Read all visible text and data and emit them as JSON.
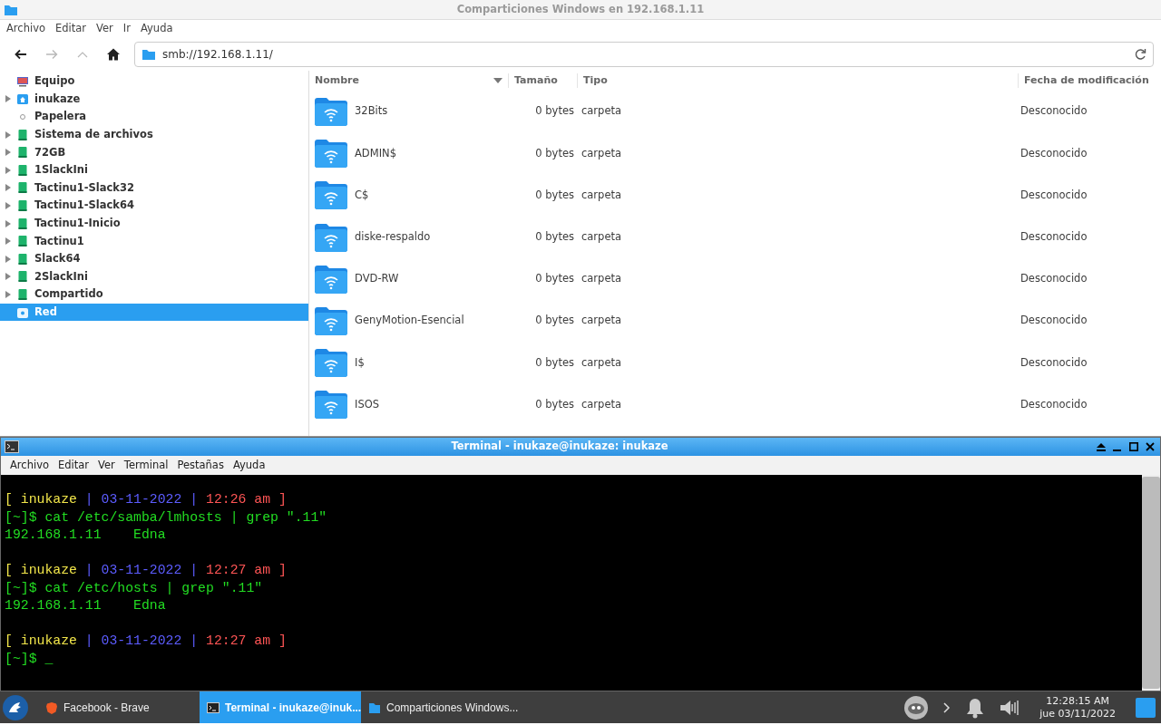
{
  "file_manager": {
    "title": "Comparticiones Windows en 192.168.1.11",
    "menu": [
      "Archivo",
      "Editar",
      "Ver",
      "Ir",
      "Ayuda"
    ],
    "toolbar": {
      "back_disabled": false,
      "forward_disabled": true,
      "up_disabled": true
    },
    "location": "smb://192.168.1.11/",
    "sidebar": {
      "items": [
        {
          "label": "Equipo",
          "kind": "computer",
          "expander": false,
          "selected": false
        },
        {
          "label": "inukaze",
          "kind": "home",
          "expander": true,
          "selected": false
        },
        {
          "label": "Papelera",
          "kind": "trash",
          "expander": false,
          "selected": false
        },
        {
          "label": "Sistema de archivos",
          "kind": "drive",
          "expander": true,
          "selected": false
        },
        {
          "label": "72GB",
          "kind": "drive",
          "expander": true,
          "selected": false
        },
        {
          "label": "1SlackIni",
          "kind": "drive",
          "expander": true,
          "selected": false
        },
        {
          "label": "Tactinu1-Slack32",
          "kind": "drive",
          "expander": true,
          "selected": false
        },
        {
          "label": "Tactinu1-Slack64",
          "kind": "drive",
          "expander": true,
          "selected": false
        },
        {
          "label": "Tactinu1-Inicio",
          "kind": "drive",
          "expander": true,
          "selected": false
        },
        {
          "label": "Tactinu1",
          "kind": "drive",
          "expander": true,
          "selected": false
        },
        {
          "label": "Slack64",
          "kind": "drive",
          "expander": true,
          "selected": false
        },
        {
          "label": "2SlackIni",
          "kind": "drive",
          "expander": true,
          "selected": false
        },
        {
          "label": "Compartido",
          "kind": "drive",
          "expander": true,
          "selected": false
        },
        {
          "label": "Red",
          "kind": "network",
          "expander": false,
          "selected": true
        }
      ]
    },
    "table": {
      "columns": [
        {
          "label": "Nombre",
          "sorted": true
        },
        {
          "label": "Tamaño",
          "sorted": false
        },
        {
          "label": "Tipo",
          "sorted": false
        },
        {
          "label": "Fecha de modificación",
          "sorted": false
        }
      ],
      "rows": [
        {
          "name": "32Bits",
          "size": "0 bytes",
          "type": "carpeta",
          "modified": "Desconocido"
        },
        {
          "name": "ADMIN$",
          "size": "0 bytes",
          "type": "carpeta",
          "modified": "Desconocido"
        },
        {
          "name": "C$",
          "size": "0 bytes",
          "type": "carpeta",
          "modified": "Desconocido"
        },
        {
          "name": "diske-respaldo",
          "size": "0 bytes",
          "type": "carpeta",
          "modified": "Desconocido"
        },
        {
          "name": "DVD-RW",
          "size": "0 bytes",
          "type": "carpeta",
          "modified": "Desconocido"
        },
        {
          "name": "GenyMotion-Esencial",
          "size": "0 bytes",
          "type": "carpeta",
          "modified": "Desconocido"
        },
        {
          "name": "I$",
          "size": "0 bytes",
          "type": "carpeta",
          "modified": "Desconocido"
        },
        {
          "name": "ISOS",
          "size": "0 bytes",
          "type": "carpeta",
          "modified": "Desconocido"
        }
      ]
    }
  },
  "terminal": {
    "title": "Terminal - inukaze@inukaze: inukaze",
    "menu": [
      "Archivo",
      "Editar",
      "Ver",
      "Terminal",
      "Pestañas",
      "Ayuda"
    ],
    "blocks": [
      {
        "lines": [
          [
            {
              "text": "[ inukaze ",
              "color": "#f2e64a"
            },
            {
              "text": "| 03-11-2022 |",
              "color": "#5c5cff"
            },
            {
              "text": " 12:26 am ]",
              "color": "#ff5555"
            }
          ],
          [
            {
              "text": "[~]$ cat /etc/samba/lmhosts | grep \".11\"",
              "color": "#22dd22"
            }
          ],
          [
            {
              "text": "192.168.1.11    Edna",
              "color": "#22dd22"
            }
          ]
        ]
      },
      {
        "lines": [
          [
            {
              "text": "[ inukaze ",
              "color": "#f2e64a"
            },
            {
              "text": "| 03-11-2022 |",
              "color": "#5c5cff"
            },
            {
              "text": " 12:27 am ]",
              "color": "#ff5555"
            }
          ],
          [
            {
              "text": "[~]$ cat /etc/hosts | grep \".11\"",
              "color": "#22dd22"
            }
          ],
          [
            {
              "text": "192.168.1.11    Edna",
              "color": "#22dd22"
            }
          ]
        ]
      },
      {
        "lines": [
          [
            {
              "text": "[ inukaze ",
              "color": "#f2e64a"
            },
            {
              "text": "| 03-11-2022 |",
              "color": "#5c5cff"
            },
            {
              "text": " 12:27 am ]",
              "color": "#ff5555"
            }
          ],
          [
            {
              "text": "[~]$ _",
              "color": "#22dd22"
            }
          ]
        ]
      }
    ]
  },
  "taskbar": {
    "tasks": [
      {
        "label": "Facebook - Brave",
        "kind": "browser",
        "selected": false
      },
      {
        "label": "Terminal - inukaze@inuk...",
        "kind": "terminal",
        "selected": true
      },
      {
        "label": "Comparticiones Windows...",
        "kind": "folder",
        "selected": false
      }
    ],
    "clock": {
      "time": "12:28:15 AM",
      "date": "jue 03/11/2022"
    }
  }
}
